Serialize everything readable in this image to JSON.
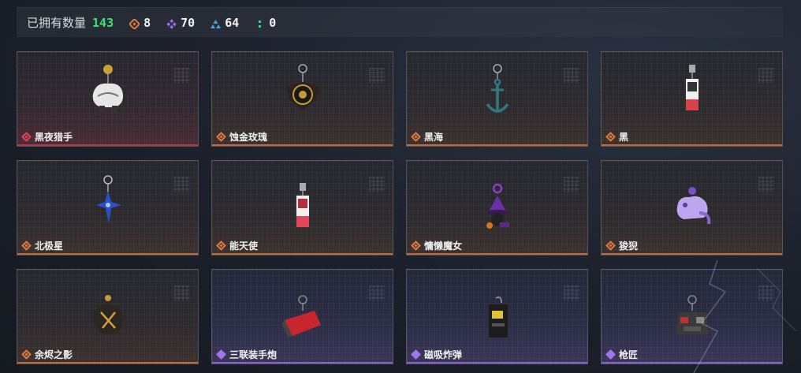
{
  "header": {
    "owned_label": "已拥有数量",
    "owned_count": "143",
    "stats": [
      {
        "icon": "orange-diamond-icon",
        "color": "#e07a3c",
        "value": "8"
      },
      {
        "icon": "purple-diamond-icon",
        "color": "#9b6ce8",
        "value": "70"
      },
      {
        "icon": "blue-triangle-icon",
        "color": "#4aa2e6",
        "value": "64"
      },
      {
        "icon": "green-dots-icon",
        "color": "#3fcf8e",
        "value": "0"
      }
    ]
  },
  "cards": [
    {
      "name": "黑夜猎手",
      "rarity": "red",
      "icon": "white-wolf-charm-icon"
    },
    {
      "name": "蚀金玫瑰",
      "rarity": "orange",
      "icon": "black-rose-charm-icon"
    },
    {
      "name": "黑海",
      "rarity": "orange",
      "icon": "anchor-charm-icon"
    },
    {
      "name": "黑",
      "rarity": "orange",
      "icon": "tag-charm-icon"
    },
    {
      "name": "北极星",
      "rarity": "orange",
      "icon": "star-charm-icon"
    },
    {
      "name": "能天使",
      "rarity": "orange",
      "icon": "tag-charm-icon"
    },
    {
      "name": "慵懒魔女",
      "rarity": "orange",
      "icon": "witch-charm-icon"
    },
    {
      "name": "狻猊",
      "rarity": "orange",
      "icon": "lion-charm-icon"
    },
    {
      "name": "余烬之影",
      "rarity": "orange",
      "icon": "shadow-charm-icon"
    },
    {
      "name": "三联装手炮",
      "rarity": "purple",
      "icon": "cannon-charm-icon"
    },
    {
      "name": "磁吸炸弹",
      "rarity": "purple",
      "icon": "bomb-charm-icon"
    },
    {
      "name": "枪匠",
      "rarity": "purple",
      "icon": "vest-charm-icon"
    }
  ]
}
